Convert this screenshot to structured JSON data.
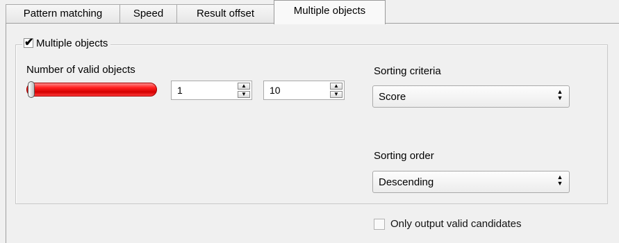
{
  "tabs": [
    {
      "label": "Pattern matching"
    },
    {
      "label": "Speed"
    },
    {
      "label": "Result offset"
    },
    {
      "label": "Multiple objects"
    }
  ],
  "group": {
    "title": "Multiple objects",
    "checked": true
  },
  "valid_objects": {
    "label": "Number of valid objects",
    "slider_color": "#e00000",
    "min_value": "1",
    "max_value": "10"
  },
  "sorting_criteria": {
    "label": "Sorting criteria",
    "selected": "Score"
  },
  "sorting_order": {
    "label": "Sorting order",
    "selected": "Descending"
  },
  "only_valid": {
    "label": "Only output valid candidates",
    "checked": false
  }
}
